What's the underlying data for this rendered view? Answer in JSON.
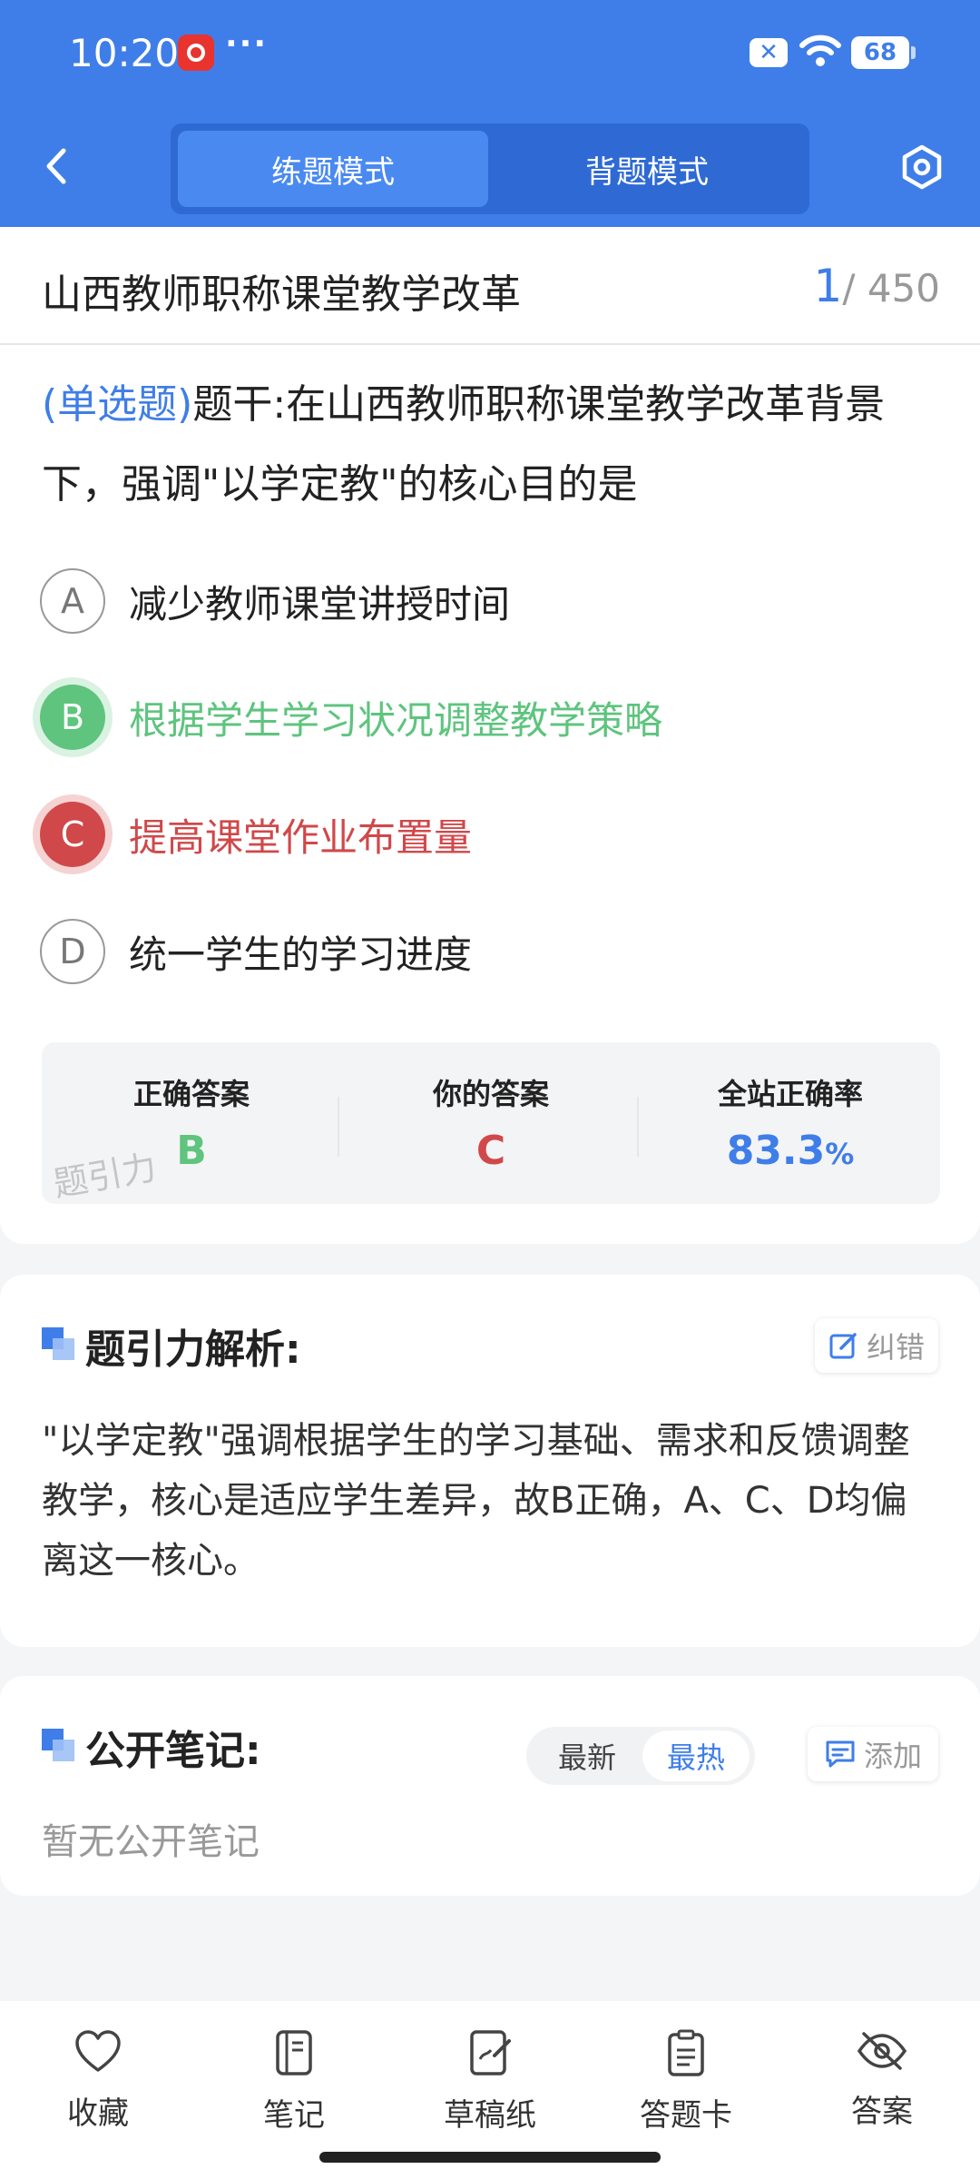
{
  "status_bar": {
    "time": "10:20",
    "dots": "···",
    "battery": "68"
  },
  "header": {
    "mode_practice": "练题模式",
    "mode_memorize": "背题模式"
  },
  "question_card": {
    "subject_title": "山西教师职称课堂教学改革",
    "progress_current": "1",
    "progress_total": "/ 450",
    "question_type": "(单选题)",
    "question_text": "题干:在山西教师职称课堂教学改革背景下，强调\"以学定教\"的核心目的是",
    "options": [
      {
        "letter": "A",
        "text": "减少教师课堂讲授时间",
        "state": "normal"
      },
      {
        "letter": "B",
        "text": "根据学生学习状况调整教学策略",
        "state": "correct"
      },
      {
        "letter": "C",
        "text": "提高课堂作业布置量",
        "state": "wrong"
      },
      {
        "letter": "D",
        "text": "统一学生的学习进度",
        "state": "normal"
      }
    ],
    "answer_summary": {
      "correct_label": "正确答案",
      "correct_value": "B",
      "yours_label": "你的答案",
      "yours_value": "C",
      "rate_label": "全站正确率",
      "rate_value": "83.3",
      "rate_unit": "%",
      "watermark": "题引力"
    }
  },
  "analysis": {
    "title": "题引力解析:",
    "correction_label": "纠错",
    "text": "\"以学定教\"强调根据学生的学习基础、需求和反馈调整教学，核心是适应学生差异，故B正确，A、C、D均偏离这一核心。"
  },
  "notes": {
    "title": "公开笔记:",
    "sort_newest": "最新",
    "sort_hottest": "最热",
    "add_label": "添加",
    "empty_text": "暂无公开笔记"
  },
  "bottom_bar": {
    "items": [
      {
        "label": "收藏",
        "icon": "heart-icon"
      },
      {
        "label": "笔记",
        "icon": "notebook-icon"
      },
      {
        "label": "草稿纸",
        "icon": "draft-paper-icon"
      },
      {
        "label": "答题卡",
        "icon": "answer-sheet-icon"
      },
      {
        "label": "答案",
        "icon": "eye-off-icon"
      }
    ]
  },
  "colors": {
    "primary": "#3f7ee8",
    "correct": "#5ec47e",
    "wrong": "#d0484a"
  }
}
